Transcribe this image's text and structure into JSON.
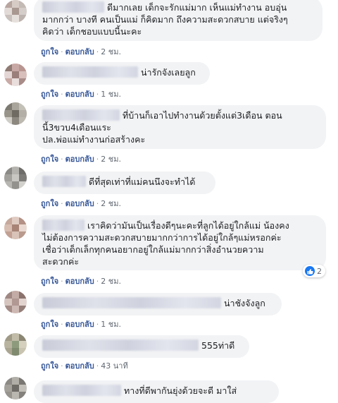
{
  "actions": {
    "like": "ถูกใจ",
    "reply": "ตอบกลับ"
  },
  "comments": [
    {
      "text_lines": [
        "ดีมากเลย เด็กจะรักแม่มาก เห็นแม่ทำงาน อบอุ่น",
        "มากกว่า บางที คนเป็นแม่ ก็คิดมาก ถึงความสะดวกสบาย แต่จริงๆ",
        "คิดว่า เด็กชอบแบบนี้นะคะ"
      ],
      "time": "2 ชม."
    },
    {
      "text_lines": [
        "น่ารักจังเลยลูก"
      ],
      "time": "1 ชม."
    },
    {
      "text_lines": [
        "ที่บ้านก็เอาไปทำงานด้วยตั้งแต่3เดือน ตอน",
        "นี้3ขวบ4เดือนแระ",
        "ปล.พ่อแม่ทำงานก่อสร้างคะ"
      ],
      "time": "2 ชม."
    },
    {
      "text_lines": [
        "ดีที่สุดเท่าที่แม่คนนึงจะทำได้"
      ],
      "time": "2 ชม."
    },
    {
      "text_lines": [
        "เราคิดว่ามันเป็นเรื่องดีๆนะคะที่ลูกได้อยู่ใกล้แม่ น้องคง",
        "ไม่ต้องการความสะดวกสบายมากกว่าการได้อยู่ใกล้ๆแม่หรอกค่ะ",
        "เชื่อว่าเด็กเล็กทุกคนอยากอยู่ใกล้แม่มากกว่าสิ่งอำนวยความ",
        "สะดวกค่ะ"
      ],
      "time": "2 ชม.",
      "reactions": "2"
    },
    {
      "text_lines": [
        "น่าชังจังลูก"
      ],
      "time": "1 ชม."
    },
    {
      "text_lines": [
        "555ท่าดี"
      ],
      "time": "43 นาที"
    },
    {
      "text_lines": [
        "ทางที่ดีพากันยุ่งด้วยจะดี มาใส่"
      ],
      "time": ""
    }
  ],
  "colors": {
    "bubble": "#f2f3f5",
    "link": "#385898",
    "like": "#1877f2"
  }
}
